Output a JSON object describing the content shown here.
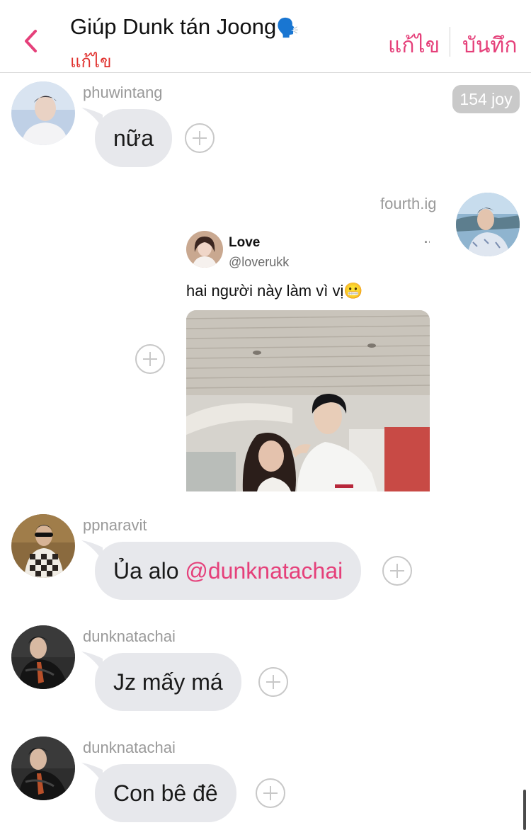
{
  "header": {
    "title": "Giúp Dunk tán Joong",
    "title_emoji": "🗣️",
    "subtitle": "แก้ไข",
    "edit_label": "แก้ไข",
    "save_label": "บันทึก",
    "back_icon": "chevron-left-icon",
    "accent_color": "#e5407a"
  },
  "badge": {
    "joy": "154 joy"
  },
  "messages": [
    {
      "username": "phuwintang",
      "text": "nữa"
    },
    {
      "username": "fourth.ig",
      "tweet": {
        "name": "Love",
        "handle": "@loverukk",
        "more": "···",
        "text": "hai người này làm vì vị😬"
      }
    },
    {
      "username": "ppnaravit",
      "text_prefix": "Ủa alo ",
      "mention": "@dunknatachai"
    },
    {
      "username": "dunknatachai",
      "text": "Jz mấy má"
    },
    {
      "username": "dunknatachai",
      "text": "Con bê đê"
    }
  ]
}
